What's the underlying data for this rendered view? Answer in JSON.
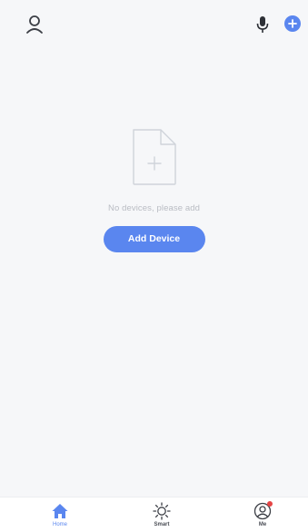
{
  "header": {
    "icons": [
      "user-icon",
      "microphone-icon",
      "plus-icon"
    ]
  },
  "empty_state": {
    "icon": "document-plus-icon",
    "message": "No devices, please add",
    "button_label": "Add Device"
  },
  "tabbar": {
    "tabs": [
      {
        "label": "Home",
        "icon": "home-icon",
        "active": true
      },
      {
        "label": "Smart",
        "icon": "sun-icon",
        "active": false
      },
      {
        "label": "Me",
        "icon": "user-circle-icon",
        "active": false,
        "badge": true
      }
    ]
  },
  "colors": {
    "accent": "#5a86ef",
    "background": "#f6f7f9",
    "badge": "#e54545"
  }
}
